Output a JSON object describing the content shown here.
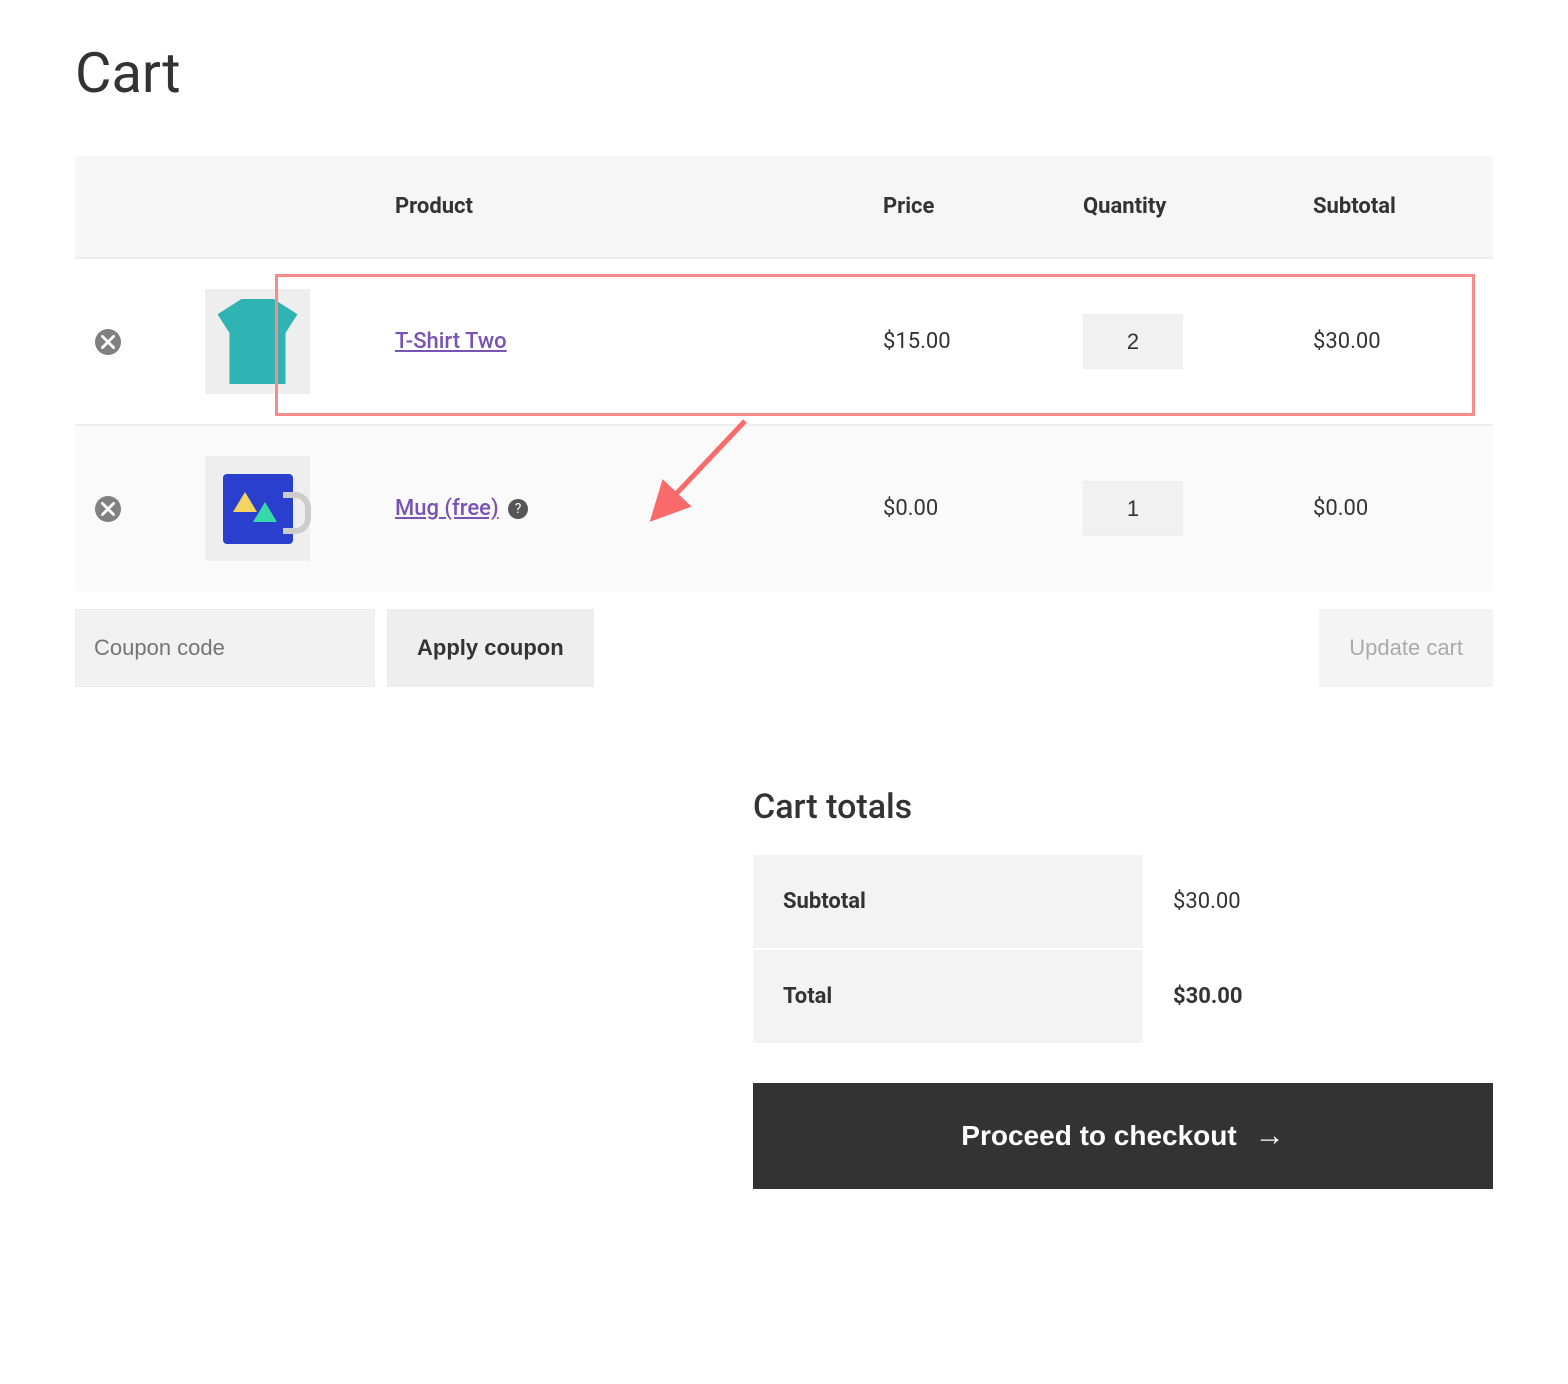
{
  "page": {
    "title": "Cart"
  },
  "table": {
    "headers": {
      "product": "Product",
      "price": "Price",
      "quantity": "Quantity",
      "subtotal": "Subtotal"
    },
    "rows": [
      {
        "product_name": "T-Shirt Two",
        "help_badge": false,
        "price": "$15.00",
        "quantity": "2",
        "subtotal": "$30.00",
        "highlighted": true,
        "icon": "tshirt"
      },
      {
        "product_name": "Mug (free)",
        "help_badge": true,
        "price": "$0.00",
        "quantity": "1",
        "subtotal": "$0.00",
        "highlighted": false,
        "icon": "mug"
      }
    ]
  },
  "coupon": {
    "placeholder": "Coupon code",
    "apply_label": "Apply coupon"
  },
  "update_cart_label": "Update cart",
  "totals": {
    "heading": "Cart totals",
    "subtotal_label": "Subtotal",
    "subtotal_value": "$30.00",
    "total_label": "Total",
    "total_value": "$30.00"
  },
  "checkout_label": "Proceed to checkout",
  "annotation": {
    "highlight_color": "#f58b8b",
    "arrow_color": "#f96a6a"
  }
}
